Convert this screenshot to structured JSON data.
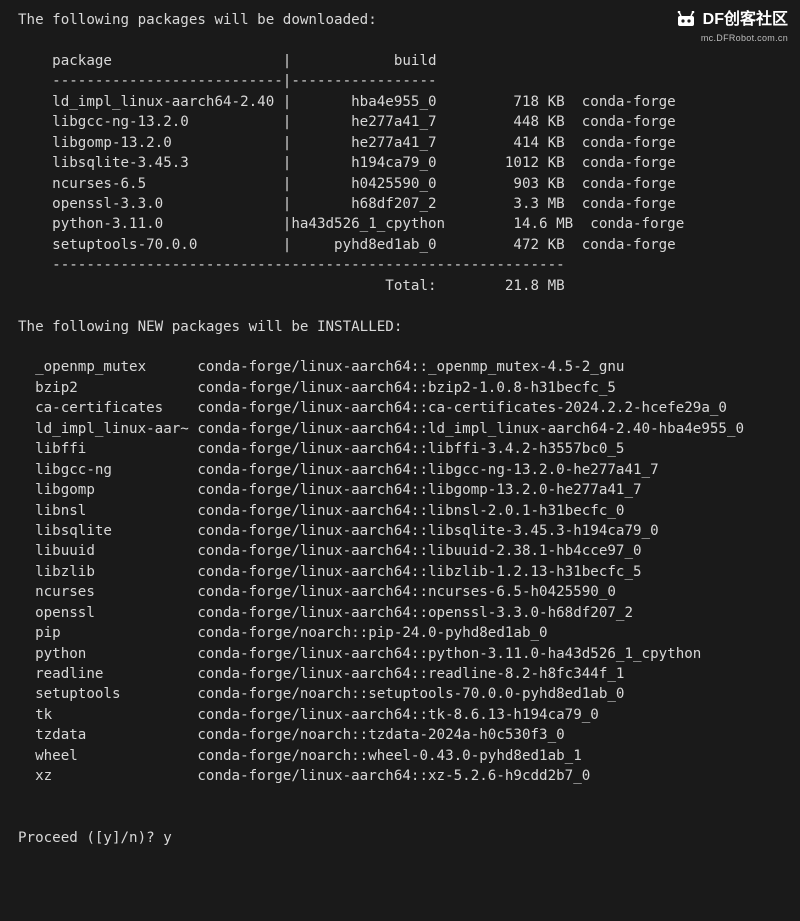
{
  "watermark": {
    "title": "DF创客社区",
    "sub": "mc.DFRobot.com.cn"
  },
  "intro_download": "The following packages will be downloaded:",
  "table_header": "    package                    |            build",
  "table_divider_top": "    ---------------------------|-----------------",
  "download_rows": [
    "    ld_impl_linux-aarch64-2.40 |       hba4e955_0         718 KB  conda-forge",
    "    libgcc-ng-13.2.0           |       he277a41_7         448 KB  conda-forge",
    "    libgomp-13.2.0             |       he277a41_7         414 KB  conda-forge",
    "    libsqlite-3.45.3           |       h194ca79_0        1012 KB  conda-forge",
    "    ncurses-6.5                |       h0425590_0         903 KB  conda-forge",
    "    openssl-3.3.0              |       h68df207_2         3.3 MB  conda-forge",
    "    python-3.11.0              |ha43d526_1_cpython        14.6 MB  conda-forge",
    "    setuptools-70.0.0          |     pyhd8ed1ab_0         472 KB  conda-forge"
  ],
  "table_divider_bottom": "    ------------------------------------------------------------",
  "total_line": "                                           Total:        21.8 MB",
  "intro_install": "The following NEW packages will be INSTALLED:",
  "install_rows": [
    "  _openmp_mutex      conda-forge/linux-aarch64::_openmp_mutex-4.5-2_gnu",
    "  bzip2              conda-forge/linux-aarch64::bzip2-1.0.8-h31becfc_5",
    "  ca-certificates    conda-forge/linux-aarch64::ca-certificates-2024.2.2-hcefe29a_0",
    "  ld_impl_linux-aar~ conda-forge/linux-aarch64::ld_impl_linux-aarch64-2.40-hba4e955_0",
    "  libffi             conda-forge/linux-aarch64::libffi-3.4.2-h3557bc0_5",
    "  libgcc-ng          conda-forge/linux-aarch64::libgcc-ng-13.2.0-he277a41_7",
    "  libgomp            conda-forge/linux-aarch64::libgomp-13.2.0-he277a41_7",
    "  libnsl             conda-forge/linux-aarch64::libnsl-2.0.1-h31becfc_0",
    "  libsqlite          conda-forge/linux-aarch64::libsqlite-3.45.3-h194ca79_0",
    "  libuuid            conda-forge/linux-aarch64::libuuid-2.38.1-hb4cce97_0",
    "  libzlib            conda-forge/linux-aarch64::libzlib-1.2.13-h31becfc_5",
    "  ncurses            conda-forge/linux-aarch64::ncurses-6.5-h0425590_0",
    "  openssl            conda-forge/linux-aarch64::openssl-3.3.0-h68df207_2",
    "  pip                conda-forge/noarch::pip-24.0-pyhd8ed1ab_0",
    "  python             conda-forge/linux-aarch64::python-3.11.0-ha43d526_1_cpython",
    "  readline           conda-forge/linux-aarch64::readline-8.2-h8fc344f_1",
    "  setuptools         conda-forge/noarch::setuptools-70.0.0-pyhd8ed1ab_0",
    "  tk                 conda-forge/linux-aarch64::tk-8.6.13-h194ca79_0",
    "  tzdata             conda-forge/noarch::tzdata-2024a-h0c530f3_0",
    "  wheel              conda-forge/noarch::wheel-0.43.0-pyhd8ed1ab_1",
    "  xz                 conda-forge/linux-aarch64::xz-5.2.6-h9cdd2b7_0"
  ],
  "prompt": "Proceed ([y]/n)? ",
  "response": "y"
}
